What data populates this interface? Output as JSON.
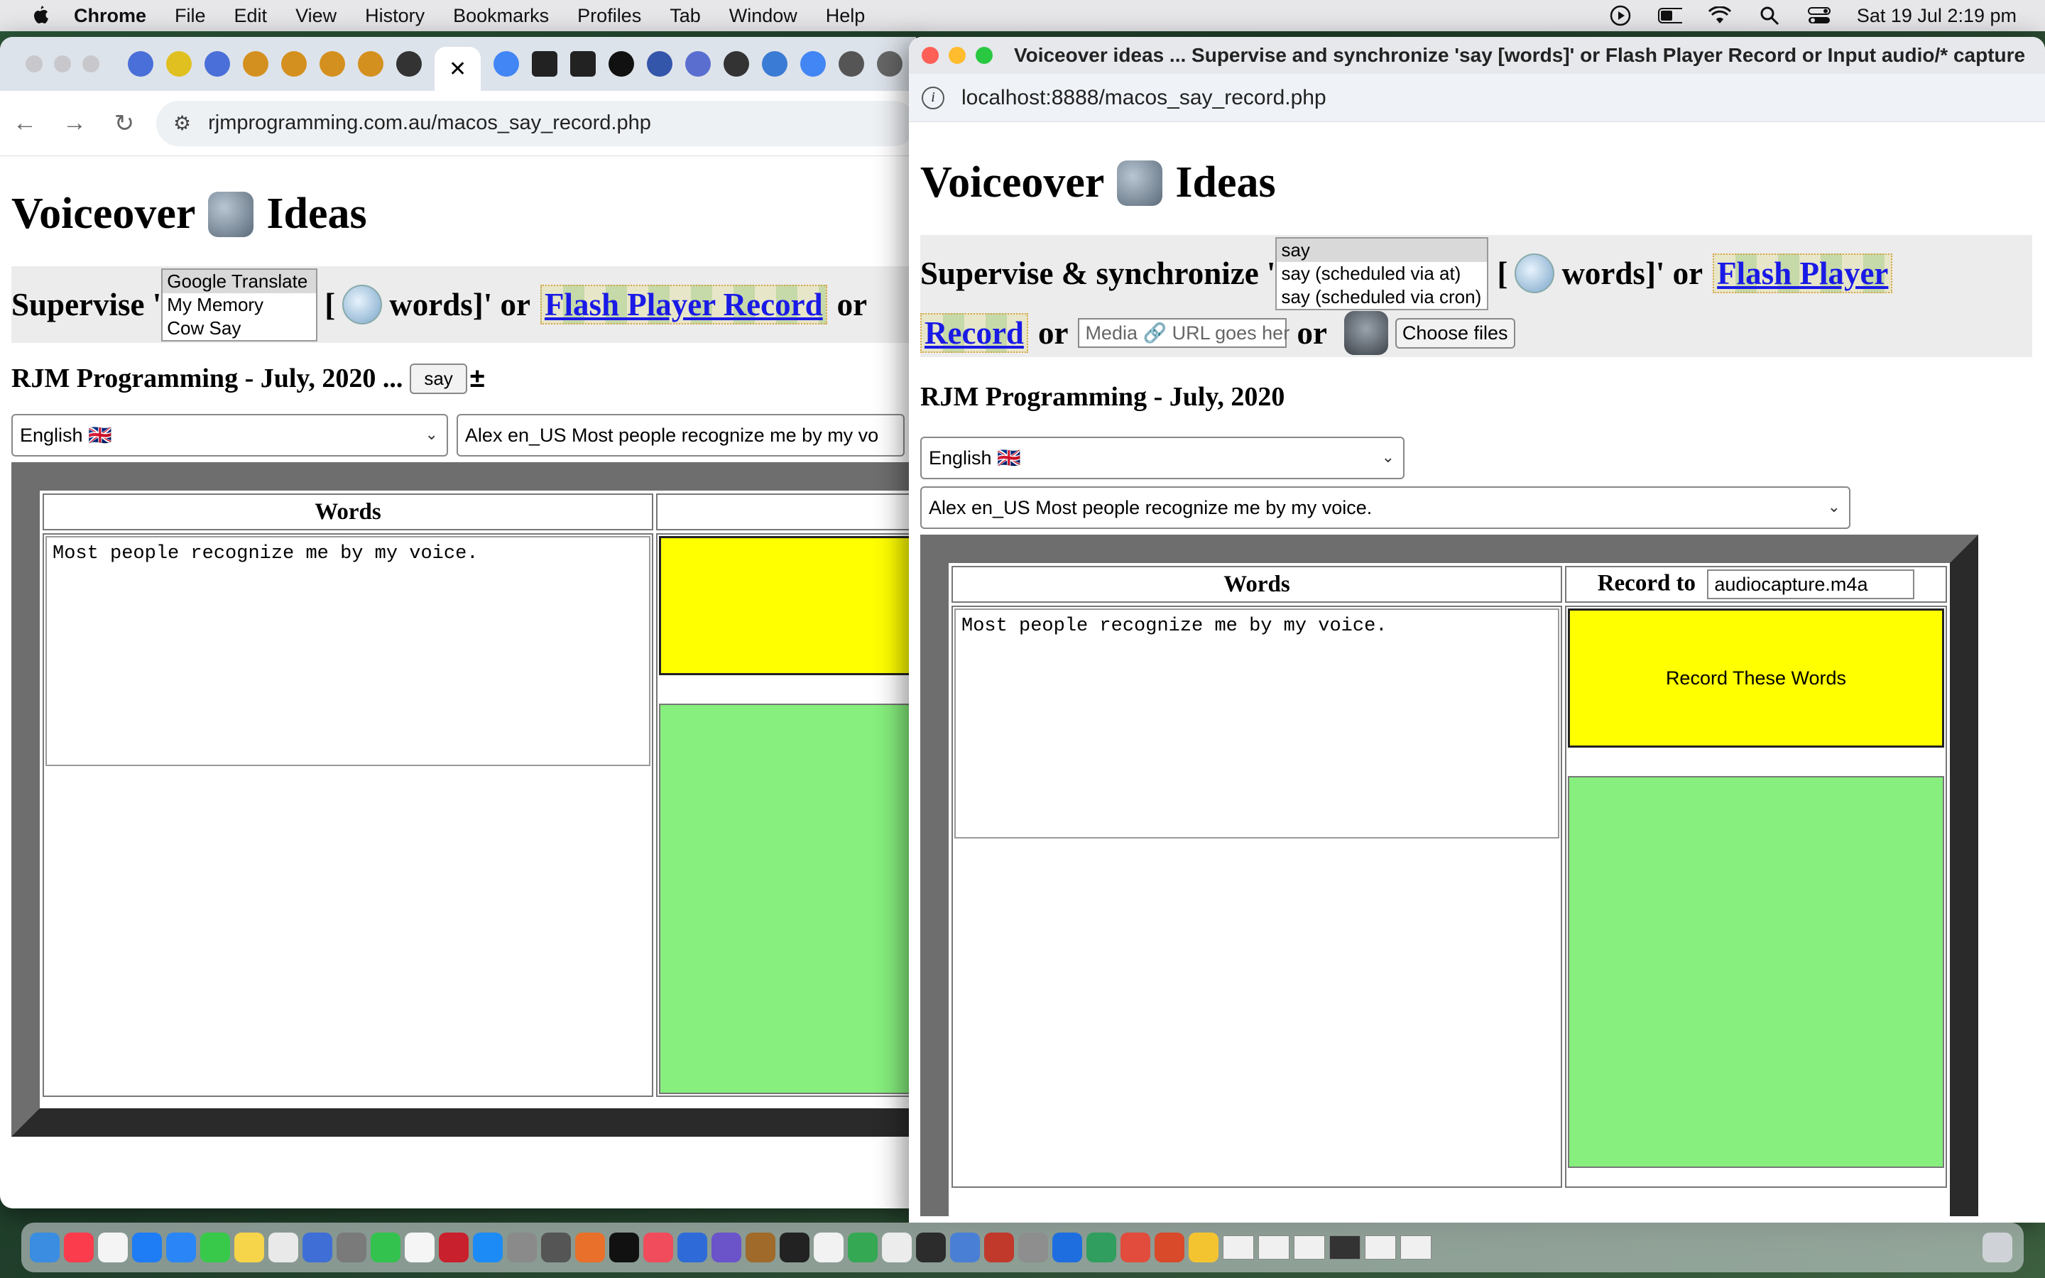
{
  "menubar": {
    "app": "Chrome",
    "items": [
      "File",
      "Edit",
      "View",
      "History",
      "Bookmarks",
      "Profiles",
      "Tab",
      "Window",
      "Help"
    ],
    "datetime": "Sat 19 Jul  2:19 pm"
  },
  "back_window": {
    "url": "rjmprogramming.com.au/macos_say_record.php",
    "tab_close": "✕",
    "heading_left": "Voiceover",
    "heading_right": "Ideas",
    "supervise": "Supervise '",
    "listbox": [
      "Google Translate",
      "My Memory",
      "Cow Say"
    ],
    "bracket": "[",
    "words": "words]' or",
    "flash_link": "Flash Player Record",
    "or": "or",
    "subtitle": "RJM Programming - July, 2020 ...",
    "say_button": "say",
    "cursor_glyph": "±",
    "language_select": "English 🇬🇧",
    "voice_select": "Alex en_US Most people recognize me by my vo",
    "table_header_words": "Words",
    "textarea_text": "Most people recognize me by my voice."
  },
  "front_window": {
    "title": "Voiceover ideas ... Supervise and synchronize 'say [words]' or Flash Player Record or Input audio/* capture",
    "url": "localhost:8888/macos_say_record.php",
    "heading_left": "Voiceover",
    "heading_right": "Ideas",
    "supervise": "Supervise & synchronize '",
    "listbox": [
      "say",
      "say (scheduled via at)",
      "say (scheduled via cron)"
    ],
    "bracket": "[",
    "words": "words]' or",
    "flash_link_1": "Flash Player",
    "flash_link_2": "Record",
    "or": "or",
    "media_placeholder": "Media 🔗 URL goes her",
    "choose_files": "Choose files",
    "subtitle": "RJM Programming - July, 2020",
    "language_select": "English 🇬🇧",
    "voice_select": "Alex en_US Most people recognize me by my voice.",
    "table_header_words": "Words",
    "record_to_label": "Record to",
    "record_to_value": "audiocapture.m4a",
    "textarea_text": "Most people recognize me by my voice.",
    "record_button": "Record These Words"
  },
  "colors": {
    "yellow": "#ffff00",
    "green": "#86ef7d",
    "link_blue": "#1a1ae6"
  }
}
